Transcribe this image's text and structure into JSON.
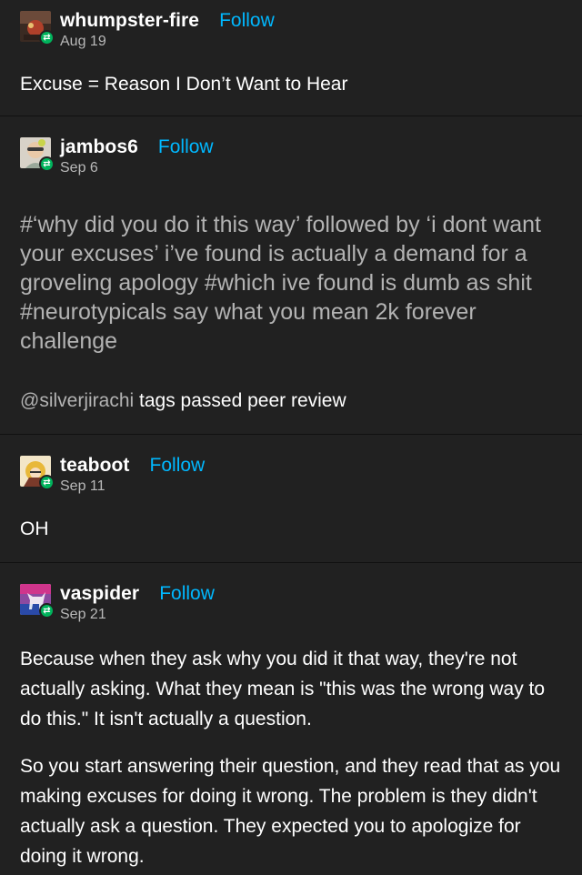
{
  "posts": [
    {
      "username": "whumpster-fire",
      "follow_label": "Follow",
      "date": "Aug 19",
      "body": "Excuse = Reason I Don’t Want to Hear"
    },
    {
      "username": "jambos6",
      "follow_label": "Follow",
      "date": "Sep 6",
      "tags": "#‘why did you do it this way’ followed by ‘i dont want your excuses’ i’ve found is actually a demand for a groveling apology  #which ive found is dumb as shit  #neurotypicals say what you mean 2k forever challenge",
      "mention": "@silverjirachi",
      "body": " tags passed peer review"
    },
    {
      "username": "teaboot",
      "follow_label": "Follow",
      "date": "Sep 11",
      "body": "OH"
    },
    {
      "username": "vaspider",
      "follow_label": "Follow",
      "date": "Sep 21",
      "paragraphs": [
        "Because when they ask why you did it that way, they're not actually asking. What they mean is \"this was the wrong way to do this.\" It isn't actually a question.",
        "So you start answering their question, and they read that as you making excuses for doing it wrong. The problem is they didn't actually ask a question. They expected you to apologize for doing it wrong."
      ]
    }
  ],
  "colors": {
    "background": "#212121",
    "follow": "#00b8ff",
    "reblog_badge": "#00b35c",
    "tags": "#b3b3b3"
  }
}
